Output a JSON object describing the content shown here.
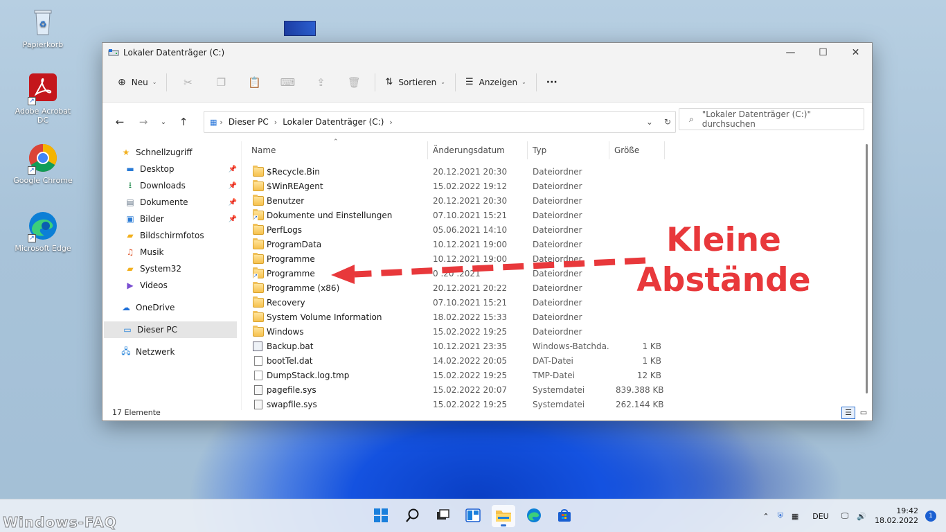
{
  "desktop": {
    "icons": [
      {
        "label": "Papierkorb",
        "icon": "recycle-bin-icon"
      },
      {
        "label": "Adobe Acrobat DC",
        "icon": "acrobat-icon"
      },
      {
        "label": "Google Chrome",
        "icon": "chrome-icon"
      },
      {
        "label": "Microsoft Edge",
        "icon": "edge-icon"
      }
    ]
  },
  "window": {
    "title": "Lokaler Datenträger (C:)",
    "controls": {
      "minimize": "—",
      "maximize": "☐",
      "close": "✕"
    }
  },
  "toolbar": {
    "new_label": "Neu",
    "sort_label": "Sortieren",
    "view_label": "Anzeigen",
    "more_label": "···"
  },
  "address": {
    "crumbs": [
      "Dieser PC",
      "Lokaler Datenträger (C:)"
    ],
    "search_placeholder": "\"Lokaler Datenträger (C:)\" durchsuchen"
  },
  "nav_pane": {
    "quick_access": "Schnellzugriff",
    "quick_items": [
      {
        "label": "Desktop",
        "pinned": true
      },
      {
        "label": "Downloads",
        "pinned": true
      },
      {
        "label": "Dokumente",
        "pinned": true
      },
      {
        "label": "Bilder",
        "pinned": true
      },
      {
        "label": "Bildschirmfotos",
        "pinned": false
      },
      {
        "label": "Musik",
        "pinned": false
      },
      {
        "label": "System32",
        "pinned": false
      },
      {
        "label": "Videos",
        "pinned": false
      }
    ],
    "onedrive": "OneDrive",
    "this_pc": "Dieser PC",
    "network": "Netzwerk"
  },
  "columns": {
    "name": "Name",
    "date": "Änderungsdatum",
    "type": "Typ",
    "size": "Größe"
  },
  "files": [
    {
      "name": "$Recycle.Bin",
      "date": "20.12.2021 20:30",
      "type": "Dateiordner",
      "size": "",
      "kind": "folder"
    },
    {
      "name": "$WinREAgent",
      "date": "15.02.2022 19:12",
      "type": "Dateiordner",
      "size": "",
      "kind": "folder"
    },
    {
      "name": "Benutzer",
      "date": "20.12.2021 20:30",
      "type": "Dateiordner",
      "size": "",
      "kind": "folder"
    },
    {
      "name": "Dokumente und Einstellungen",
      "date": "07.10.2021 15:21",
      "type": "Dateiordner",
      "size": "",
      "kind": "folder-link"
    },
    {
      "name": "PerfLogs",
      "date": "05.06.2021 14:10",
      "type": "Dateiordner",
      "size": "",
      "kind": "folder"
    },
    {
      "name": "ProgramData",
      "date": "10.12.2021 19:00",
      "type": "Dateiordner",
      "size": "",
      "kind": "folder"
    },
    {
      "name": "Programme",
      "date": "10.12.2021 19:00",
      "type": "Dateiordner",
      "size": "",
      "kind": "folder"
    },
    {
      "name": "Programme",
      "date": "0 .20 .2021",
      "type": "Dateiordner",
      "size": "",
      "kind": "folder-link"
    },
    {
      "name": "Programme (x86)",
      "date": "20.12.2021 20:22",
      "type": "Dateiordner",
      "size": "",
      "kind": "folder"
    },
    {
      "name": "Recovery",
      "date": "07.10.2021 15:21",
      "type": "Dateiordner",
      "size": "",
      "kind": "folder"
    },
    {
      "name": "System Volume Information",
      "date": "18.02.2022 15:33",
      "type": "Dateiordner",
      "size": "",
      "kind": "folder"
    },
    {
      "name": "Windows",
      "date": "15.02.2022 19:25",
      "type": "Dateiordner",
      "size": "",
      "kind": "folder"
    },
    {
      "name": "Backup.bat",
      "date": "10.12.2021 23:35",
      "type": "Windows-Batchda...",
      "size": "1 KB",
      "kind": "bat"
    },
    {
      "name": "bootTel.dat",
      "date": "14.02.2022 20:05",
      "type": "DAT-Datei",
      "size": "1 KB",
      "kind": "file"
    },
    {
      "name": "DumpStack.log.tmp",
      "date": "15.02.2022 19:25",
      "type": "TMP-Datei",
      "size": "12 KB",
      "kind": "file"
    },
    {
      "name": "pagefile.sys",
      "date": "15.02.2022 20:07",
      "type": "Systemdatei",
      "size": "839.388 KB",
      "kind": "sys"
    },
    {
      "name": "swapfile.sys",
      "date": "15.02.2022 19:25",
      "type": "Systemdatei",
      "size": "262.144 KB",
      "kind": "sys"
    }
  ],
  "status": {
    "count": "17 Elemente"
  },
  "annotation": {
    "line1": "Kleine",
    "line2": "Abstände",
    "color": "#e8383b"
  },
  "taskbar": {
    "language": "DEU",
    "time": "19:42",
    "date": "18.02.2022",
    "notifications": "1",
    "watermark": "Windows-FAQ"
  },
  "colors": {
    "accent": "#2b6fd1",
    "folder": "#f6c14d",
    "selection": "#e5e5e5"
  }
}
